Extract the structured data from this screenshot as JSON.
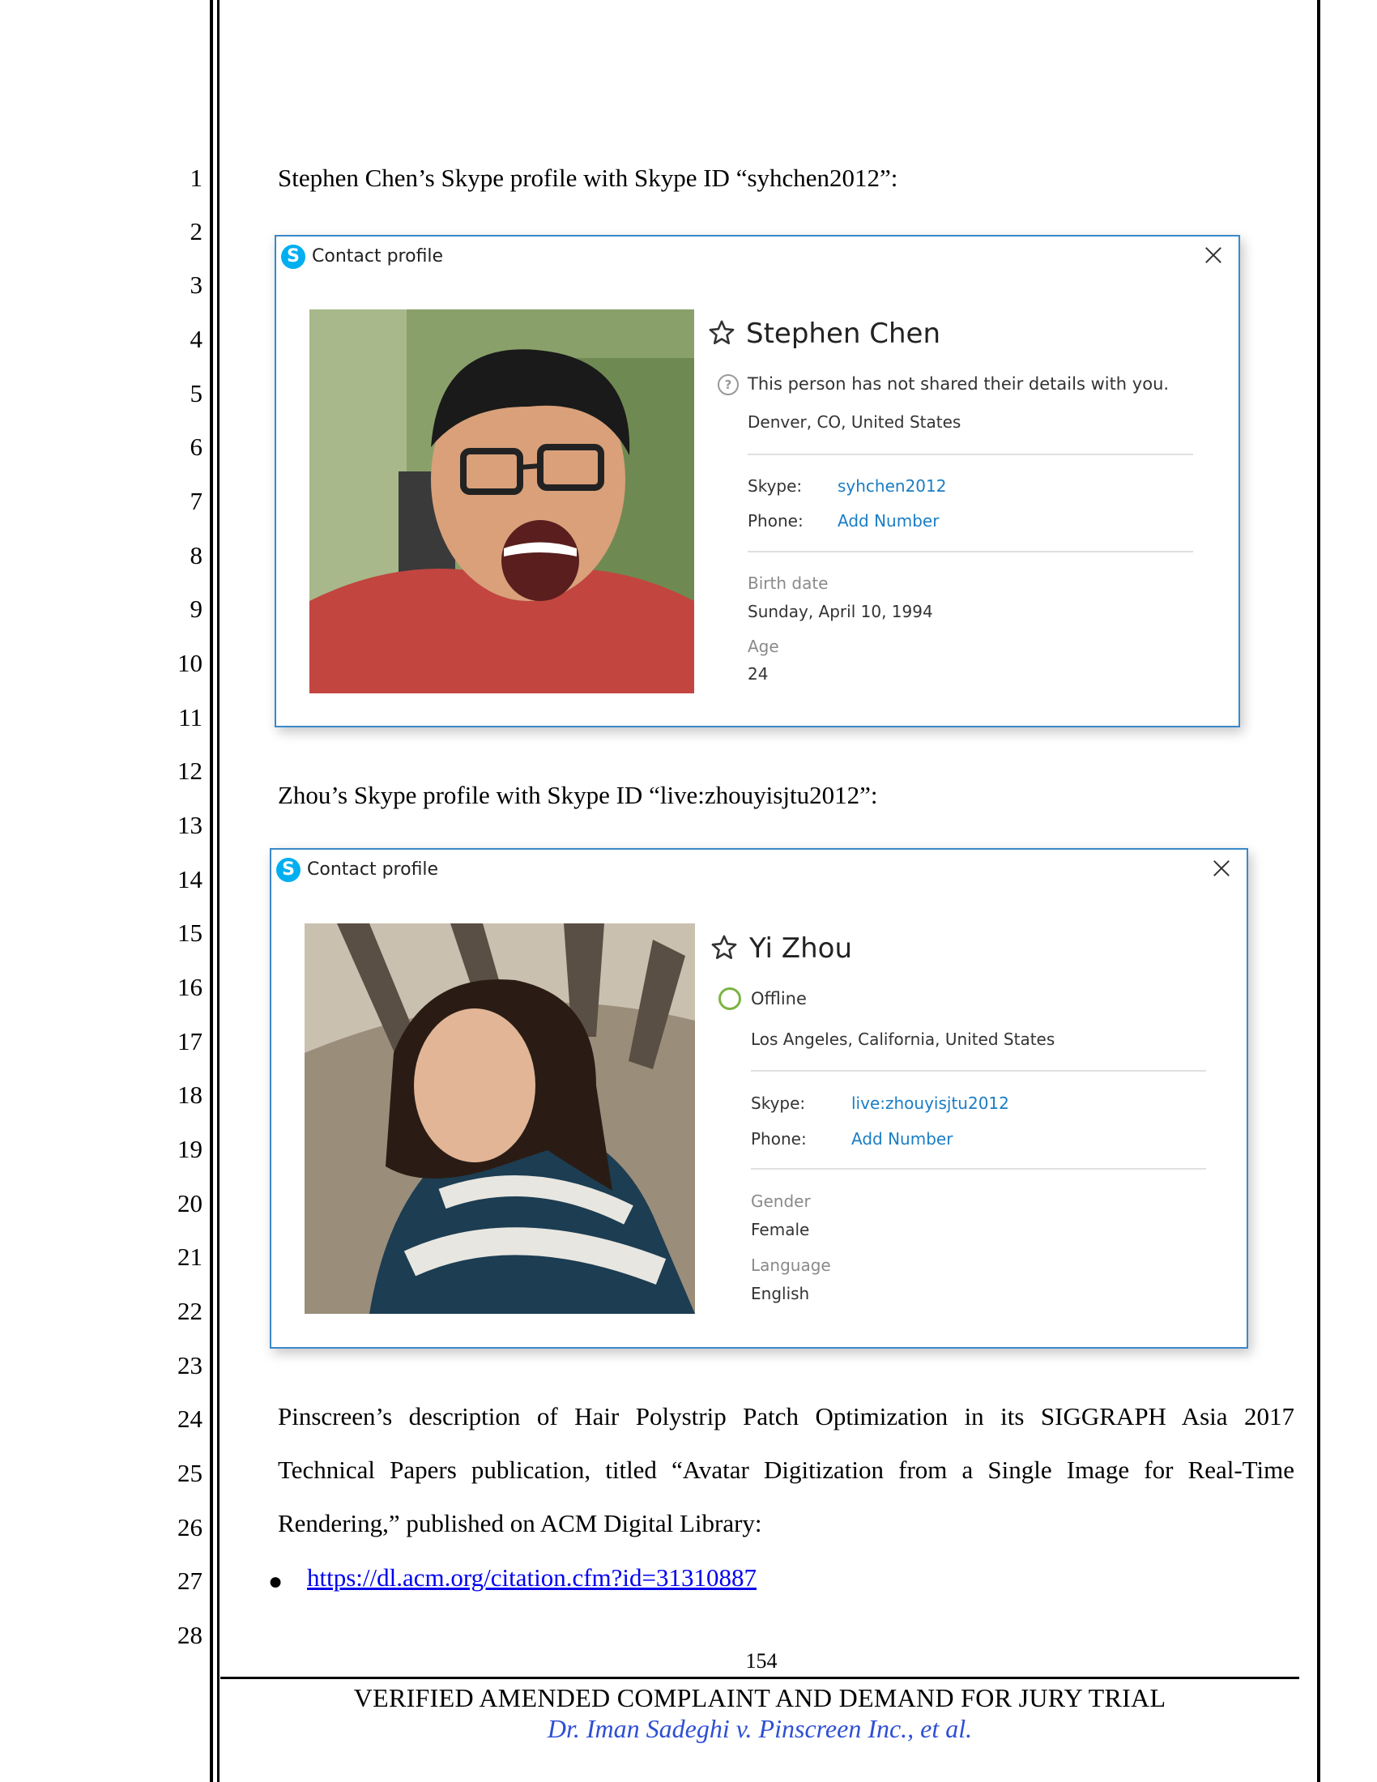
{
  "line_numbers": [
    "1",
    "2",
    "3",
    "4",
    "5",
    "6",
    "7",
    "8",
    "9",
    "10",
    "11",
    "12",
    "13",
    "14",
    "15",
    "16",
    "17",
    "18",
    "19",
    "20",
    "21",
    "22",
    "23",
    "24",
    "25",
    "26",
    "27",
    "28"
  ],
  "intro_chen": "Stephen Chen’s Skype profile with Skype ID “syhchen2012”:",
  "intro_zhou": "Zhou’s Skype profile with Skype ID “live:zhouyisjtu2012”:",
  "profiles": [
    {
      "window_title": "Contact profile",
      "name": "Stephen Chen",
      "status": "This person has not shared their details with you.",
      "location": "Denver, CO, United States",
      "skype_label": "Skype:",
      "skype_id": "syhchen2012",
      "phone_label": "Phone:",
      "phone_action": "Add Number",
      "extra1_label": "Birth date",
      "extra1_value": "Sunday, April 10, 1994",
      "extra2_label": "Age",
      "extra2_value": "24"
    },
    {
      "window_title": "Contact profile",
      "name": "Yi Zhou",
      "status": "Offline",
      "location": "Los Angeles, California, United States",
      "skype_label": "Skype:",
      "skype_id": "live:zhouyisjtu2012",
      "phone_label": "Phone:",
      "phone_action": "Add Number",
      "extra1_label": "Gender",
      "extra1_value": "Female",
      "extra2_label": "Language",
      "extra2_value": "English"
    }
  ],
  "paragraph_lines": [
    "Pinscreen’s description of Hair Polystrip Patch Optimization in its SIGGRAPH Asia 2017",
    "Technical Papers publication, titled “Avatar Digitization from a Single Image for Real-Time",
    "Rendering,” published on ACM Digital Library:"
  ],
  "link_text": "https://dl.acm.org/citation.cfm?id=31310887",
  "footer": {
    "page_number": "154",
    "title": "VERIFIED AMENDED COMPLAINT AND DEMAND FOR JURY TRIAL",
    "case": "Dr. Iman Sadeghi v. Pinscreen Inc., et al."
  },
  "colors": {
    "skype_blue": "#00aff0",
    "link_blue": "#1a7dc4",
    "dialog_border": "#3a88c9",
    "offline_green": "#7cb342"
  }
}
